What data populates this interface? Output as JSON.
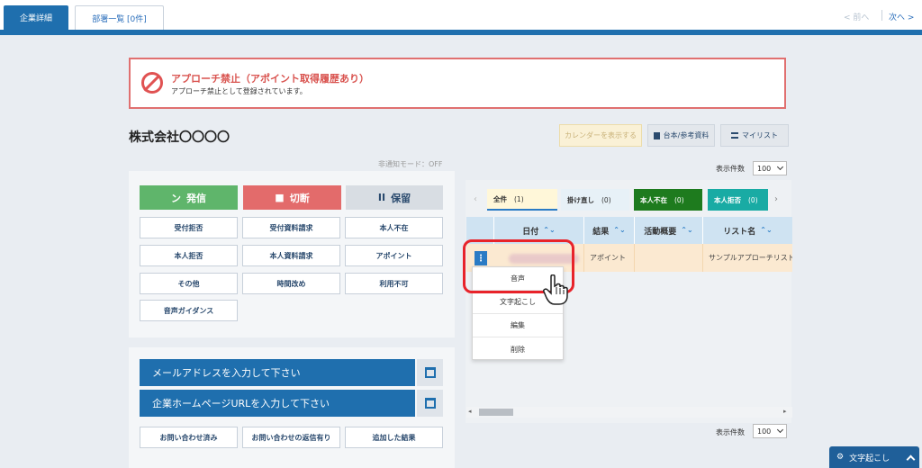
{
  "tabs": [
    {
      "label": "企業詳細",
      "active": true
    },
    {
      "label": "部署一覧 [0件]",
      "active": false
    }
  ],
  "pager": {
    "prev": "< 前へ",
    "next": "次へ >"
  },
  "alert": {
    "title": "アプローチ禁止（アポイント取得履歴あり）",
    "subtitle": "アプローチ禁止として登録されています。"
  },
  "company_name": "株式会社〇〇〇〇",
  "toolbar": {
    "calendar": "カレンダーを表示する",
    "reference": "台本/参考資料",
    "mylist": "マイリスト"
  },
  "notify_mode": "非通知モード：OFF",
  "call_actions": {
    "call": "発信",
    "hangup": "切断",
    "hold": "保留"
  },
  "results": [
    "受付拒否",
    "受付資料請求",
    "本人不在",
    "本人拒否",
    "本人資料請求",
    "アポイント",
    "その他",
    "時間改め",
    "利用不可",
    "音声ガイダンス"
  ],
  "inputs": {
    "email": "メールアドレスを入力して下さい",
    "url": "企業ホームページURLを入力して下さい"
  },
  "inquiry_buttons": [
    "お問い合わせ済み",
    "お問い合わせの返信有り",
    "追加した結果"
  ],
  "display_count": {
    "label": "表示件数",
    "value": "100"
  },
  "filter_tabs": [
    {
      "label": "全件",
      "count": "(1)",
      "color": "#fff7d9",
      "text": "#333"
    },
    {
      "label": "掛け直し",
      "count": "(0)",
      "color": "#e7f1f7",
      "text": "#333"
    },
    {
      "label": "本人不在",
      "count": "(0)",
      "color": "#1e7b1e",
      "text": "#fff"
    },
    {
      "label": "本人拒否",
      "count": "(0)",
      "color": "#19aba4",
      "text": "#fff"
    }
  ],
  "table": {
    "headers": [
      "日付",
      "結果",
      "活動概要",
      "リスト名"
    ],
    "rows": [
      {
        "date": "",
        "result": "アポイント",
        "summary": "",
        "list": "サンプルアプローチリスト"
      }
    ]
  },
  "context_menu": [
    "音声",
    "文字起こし",
    "編集",
    "削除"
  ],
  "footer": {
    "transcribe": "文字起こし"
  }
}
